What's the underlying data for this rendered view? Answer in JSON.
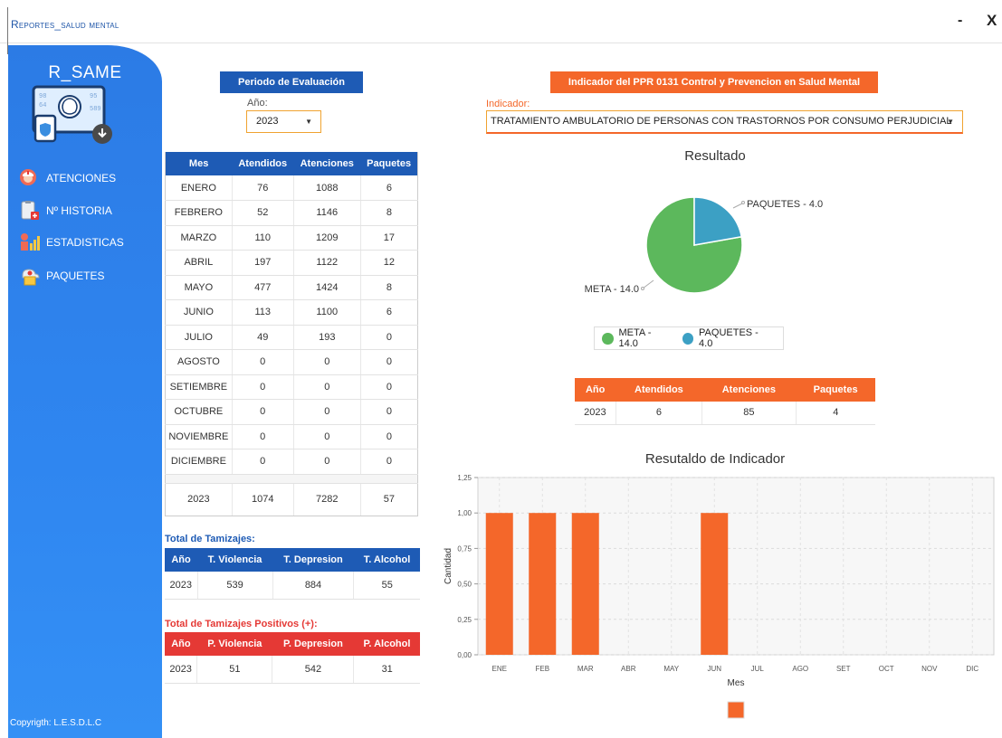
{
  "window": {
    "title": "Reportes_salud mental",
    "minimize": "-",
    "close": "X"
  },
  "sidebar": {
    "brand": "R_SAME",
    "items": [
      {
        "label": "ATENCIONES",
        "icon": "nurse-icon"
      },
      {
        "label": "Nº HISTORIA",
        "icon": "clipboard-icon"
      },
      {
        "label": "ESTADISTICAS",
        "icon": "people-stats-icon"
      },
      {
        "label": "PAQUETES",
        "icon": "cloud-package-icon"
      }
    ],
    "copyright": "Copyrigth: L.E.S.D.L.C"
  },
  "period": {
    "header": "Periodo de Evaluación",
    "year_label": "Año:",
    "year_value": "2023"
  },
  "month_table": {
    "headers": [
      "Mes",
      "Atendidos",
      "Atenciones",
      "Paquetes"
    ],
    "rows": [
      [
        "ENERO",
        "76",
        "1088",
        "6"
      ],
      [
        "FEBRERO",
        "52",
        "1146",
        "8"
      ],
      [
        "MARZO",
        "110",
        "1209",
        "17"
      ],
      [
        "ABRIL",
        "197",
        "1122",
        "12"
      ],
      [
        "MAYO",
        "477",
        "1424",
        "8"
      ],
      [
        "JUNIO",
        "113",
        "1100",
        "6"
      ],
      [
        "JULIO",
        "49",
        "193",
        "0"
      ],
      [
        "AGOSTO",
        "0",
        "0",
        "0"
      ],
      [
        "SETIEMBRE",
        "0",
        "0",
        "0"
      ],
      [
        "OCTUBRE",
        "0",
        "0",
        "0"
      ],
      [
        "NOVIEMBRE",
        "0",
        "0",
        "0"
      ],
      [
        "DICIEMBRE",
        "0",
        "0",
        "0"
      ]
    ],
    "total": [
      "2023",
      "1074",
      "7282",
      "57"
    ]
  },
  "tamizajes": {
    "title": "Total de Tamizajes:",
    "headers": [
      "Año",
      "T. Violencia",
      "T. Depresion",
      "T. Alcohol"
    ],
    "row": [
      "2023",
      "539",
      "884",
      "55"
    ]
  },
  "positivos": {
    "title": "Total de Tamizajes Positivos (+):",
    "headers": [
      "Año",
      "P. Violencia",
      "P. Depresion",
      "P. Alcohol"
    ],
    "row": [
      "2023",
      "51",
      "542",
      "31"
    ]
  },
  "indicator": {
    "header": "Indicador del PPR 0131 Control y Prevencion en Salud Mental",
    "label": "Indicador:",
    "value": "TRATAMIENTO AMBULATORIO DE PERSONAS CON TRASTORNOS POR CONSUMO PERJUDICIAL"
  },
  "summary_table": {
    "headers": [
      "Año",
      "Atendidos",
      "Atenciones",
      "Paquetes"
    ],
    "row": [
      "2023",
      "6",
      "85",
      "4"
    ]
  },
  "chart_data": [
    {
      "type": "pie",
      "title": "Resultado",
      "labels": [
        "META - 14.0",
        "PAQUETES - 4.0"
      ],
      "values": [
        14.0,
        4.0
      ],
      "colors": [
        "#5cb85c",
        "#3ca0c4"
      ],
      "legend": "bottom"
    },
    {
      "type": "bar",
      "title": "Resutaldo de Indicador",
      "xlabel": "Mes",
      "ylabel": "Cantidad",
      "categories": [
        "ENE",
        "FEB",
        "MAR",
        "ABR",
        "MAY",
        "JUN",
        "JUL",
        "AGO",
        "SET",
        "OCT",
        "NOV",
        "DIC"
      ],
      "values": [
        1,
        1,
        1,
        0,
        0,
        1,
        0,
        0,
        0,
        0,
        0,
        0
      ],
      "yticks": [
        "0,00",
        "0,25",
        "0,50",
        "0,75",
        "1,00",
        "1,25"
      ],
      "ylim": [
        0,
        1.25
      ],
      "grid": true,
      "color": "#f4672a",
      "legend": "bottom"
    }
  ]
}
